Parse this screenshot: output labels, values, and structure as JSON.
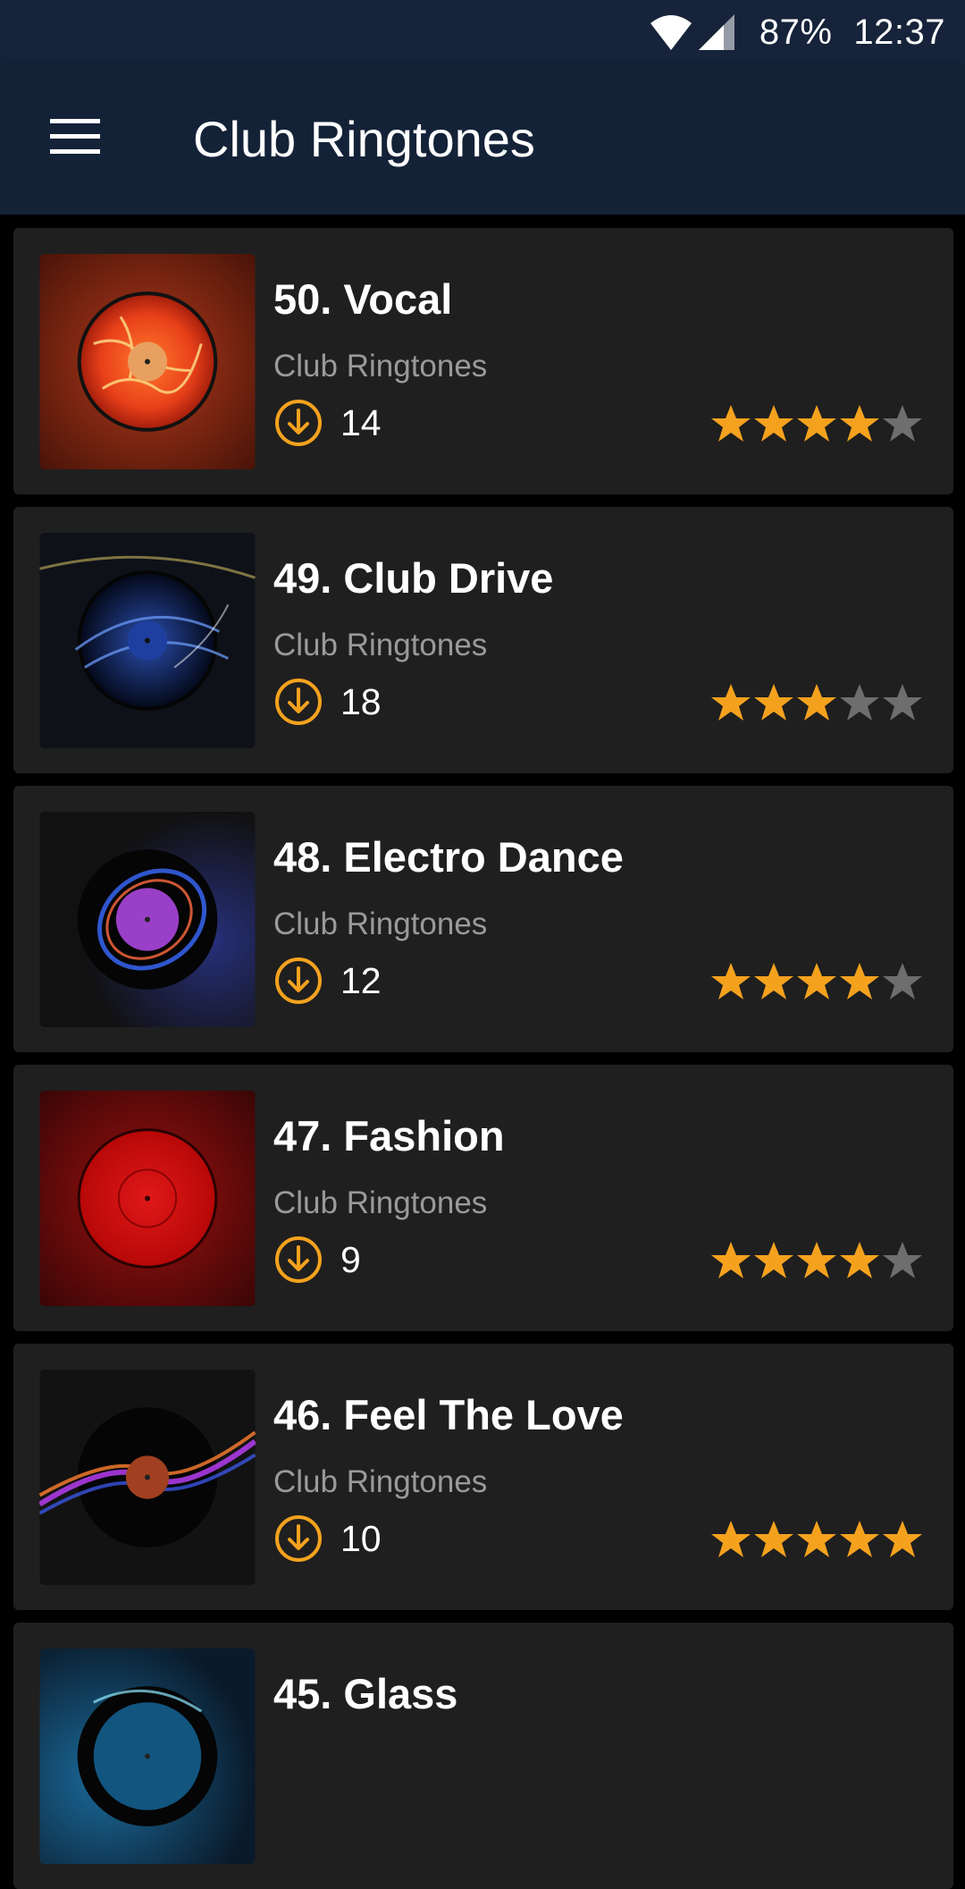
{
  "status": {
    "battery": "87%",
    "time": "12:37"
  },
  "app_bar": {
    "title": "Club Ringtones"
  },
  "colors": {
    "star_on": "#f4a21e",
    "star_off": "#6e6e6e",
    "download": "#f4a21e",
    "app_bar": "#142238"
  },
  "items": [
    {
      "title": "50. Vocal",
      "subtitle": "Club Ringtones",
      "downloads": "14",
      "rating": 4,
      "art": "fire-vinyl"
    },
    {
      "title": "49. Club Drive",
      "subtitle": "Club Ringtones",
      "downloads": "18",
      "rating": 3,
      "art": "blue-vinyl"
    },
    {
      "title": "48. Electro Dance",
      "subtitle": "Club Ringtones",
      "downloads": "12",
      "rating": 4,
      "art": "purple-vinyl"
    },
    {
      "title": "47. Fashion",
      "subtitle": "Club Ringtones",
      "downloads": "9",
      "rating": 4,
      "art": "red-vinyl"
    },
    {
      "title": "46. Feel The Love",
      "subtitle": "Club Ringtones",
      "downloads": "10",
      "rating": 5,
      "art": "rainbow-vinyl"
    },
    {
      "title": "45. Glass",
      "subtitle": "",
      "downloads": "",
      "rating": 0,
      "art": "glass-vinyl"
    }
  ]
}
